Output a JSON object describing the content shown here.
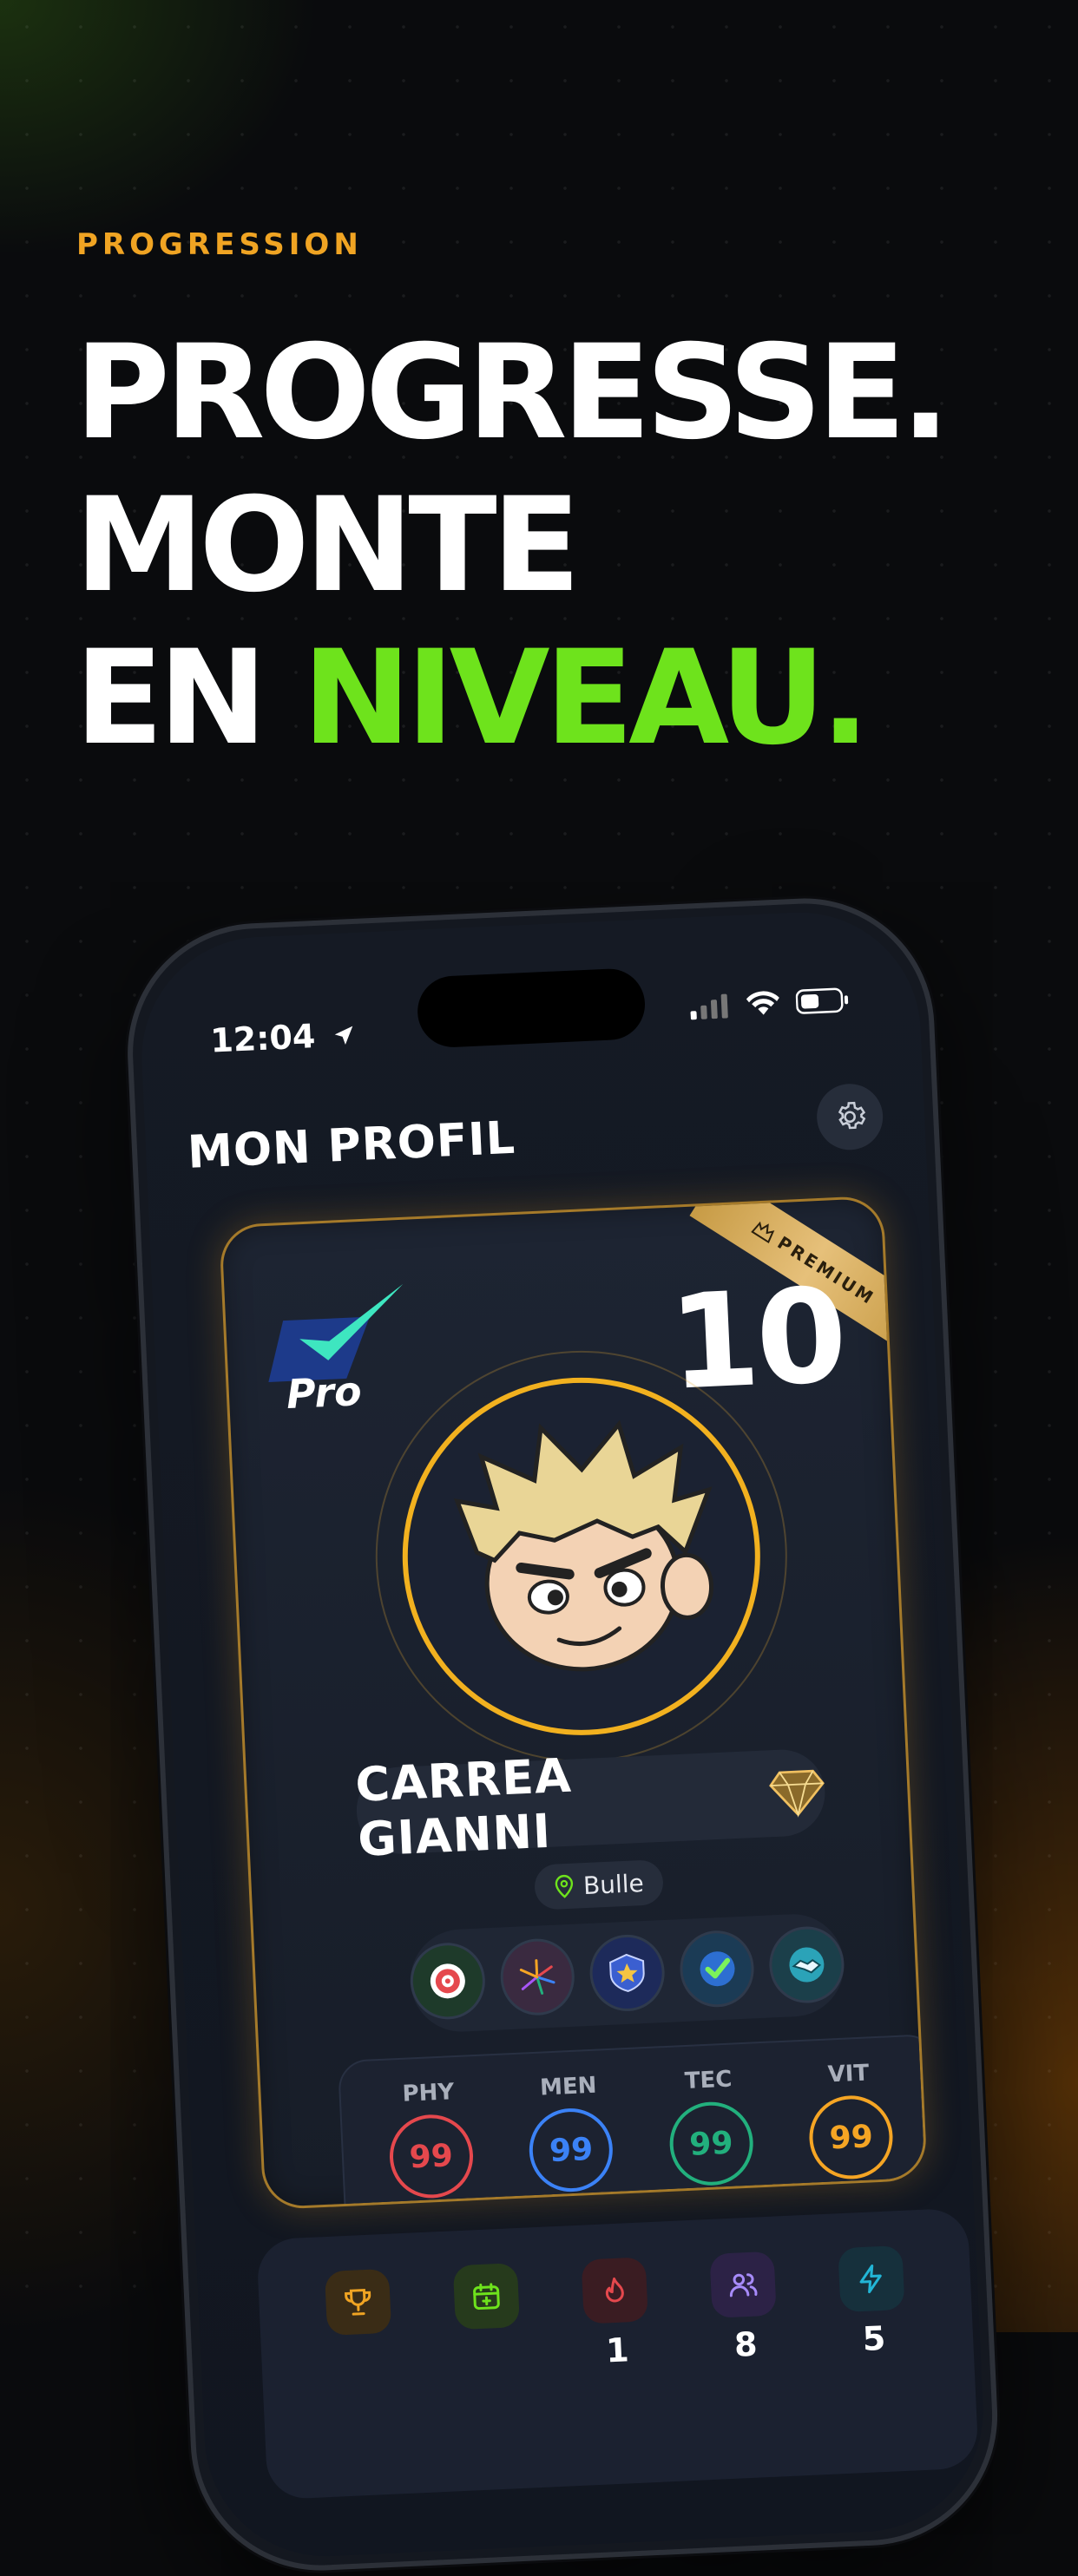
{
  "header": {
    "eyebrow": "PROGRESSION",
    "headline_line1": "PROGRESSE.",
    "headline_line2": "MONTE",
    "headline_line3_white": "EN ",
    "headline_line3_green": "NIVEAU."
  },
  "colors": {
    "accent_orange": "#f0a423",
    "accent_green": "#6ee31c",
    "gold": "#f2b11f"
  },
  "phone": {
    "status_time": "12:04",
    "screen_title": "MON PROFIL",
    "settings_icon": "gear-icon",
    "card": {
      "ribbon_text": "PREMIUM",
      "pro_label": "Pro",
      "level": "10",
      "player_name": "CARREA GIANNI",
      "location": "Bulle",
      "badges": [
        "target-badge",
        "fireworks-badge",
        "star-shield-badge",
        "check-badge",
        "handshake-badge"
      ],
      "stats": [
        {
          "label": "PHY",
          "value": "99",
          "color": "#e5484d"
        },
        {
          "label": "MEN",
          "value": "99",
          "color": "#3b82f6"
        },
        {
          "label": "TEC",
          "value": "99",
          "color": "#22b07d"
        },
        {
          "label": "VIT",
          "value": "99",
          "color": "#f5a524"
        }
      ]
    },
    "tray": [
      {
        "icon": "trophy-icon",
        "value": ""
      },
      {
        "icon": "calendar-add-icon",
        "value": ""
      },
      {
        "icon": "flame-icon",
        "value": "1"
      },
      {
        "icon": "users-icon",
        "value": "8"
      },
      {
        "icon": "lightning-icon",
        "value": "5"
      }
    ]
  }
}
